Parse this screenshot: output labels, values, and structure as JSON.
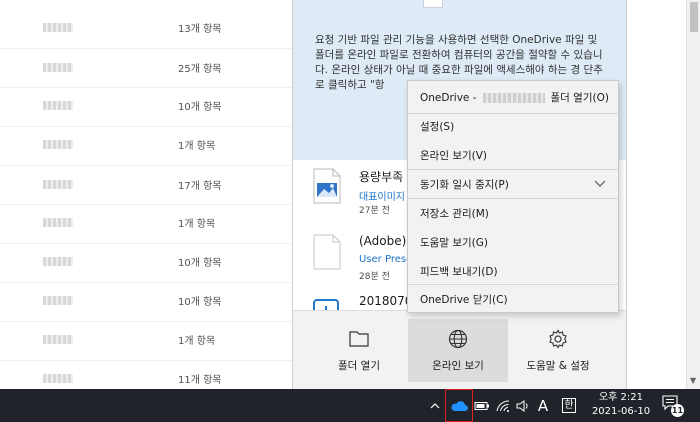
{
  "explorer": {
    "rows": [
      {
        "count": "13개 항목"
      },
      {
        "count": "25개 항목"
      },
      {
        "count": "10개 항목"
      },
      {
        "count": "1개 항목"
      },
      {
        "count": "17개 항목"
      },
      {
        "count": "1개 항목"
      },
      {
        "count": "10개 항목"
      },
      {
        "count": "10개 항목"
      },
      {
        "count": "1개 항목"
      },
      {
        "count": "11개 항목"
      }
    ]
  },
  "flyout": {
    "message": "요청 기반 파일 관리 기능을 사용하면 선택한 OneDrive 파일 및 폴더를 온라인 파일로 전환하여 컴퓨터의 공간을 절약할 수 있습니다. 온라인 상태가 아닐 때 중요한 파일에 액세스해야 하는 경 단추로 클릭하고 \"항",
    "files": [
      {
        "title": "용량부족",
        "sub": "대표이미지",
        "time": "27분 전",
        "thumb": "image-file-icon"
      },
      {
        "title": "(Adobe).l",
        "sub": "User Prese",
        "time": "28분 전",
        "thumb": "blank-file-icon"
      },
      {
        "title": "20180704",
        "sub": "",
        "time": "",
        "thumb": "document-file-icon"
      }
    ],
    "buttons": [
      {
        "label": "폴더 열기",
        "icon": "folder-icon"
      },
      {
        "label": "온라인 보기",
        "icon": "globe-icon"
      },
      {
        "label": "도움말 & 설정",
        "icon": "gear-icon"
      }
    ]
  },
  "menu": {
    "items": [
      {
        "prefix": "OneDrive - ",
        "suffix": " 폴더 열기(O)"
      },
      {
        "label": "설정(S)"
      },
      {
        "label": "온라인 보기(V)"
      },
      {
        "label": "동기화 일시 중지(P)"
      },
      {
        "label": "저장소 관리(M)"
      },
      {
        "label": "도움말 보기(G)"
      },
      {
        "label": "피드백 보내기(D)"
      },
      {
        "label": "OneDrive 닫기(C)"
      }
    ]
  },
  "taskbar": {
    "ime_mode": "A",
    "ime_lang": "한",
    "time": "오후 2:21",
    "date": "2021-06-10",
    "notification_count": "11"
  },
  "colors": {
    "onedrive_blue": "#1e90ff",
    "taskbar_bg": "#20242a",
    "highlight_red": "#e02020"
  }
}
